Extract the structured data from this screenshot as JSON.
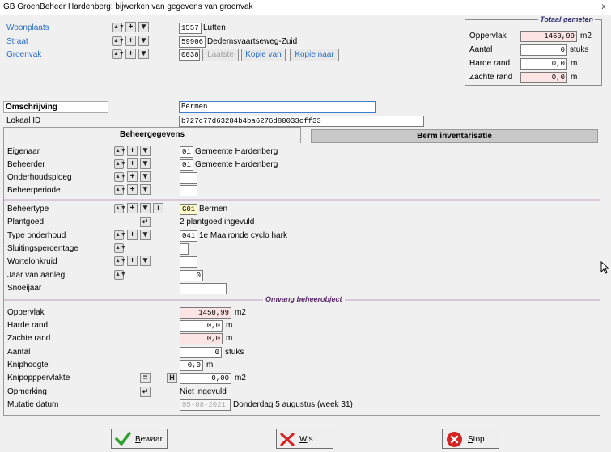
{
  "window": {
    "title": "GB GroenBeheer Hardenberg: bijwerken van gegevens van groenvak",
    "close": "x"
  },
  "header": {
    "woonplaats": {
      "label": "Woonplaats",
      "code": "1557",
      "value": "Lutten"
    },
    "straat": {
      "label": "Straat",
      "code": "59906",
      "value": "Dedemsvaartseweg-Zuid"
    },
    "groenvak": {
      "label": "Groenvak",
      "code": "0038",
      "btn_laatste": "Laatste",
      "btn_kopie_van": "Kopie van",
      "btn_kopie_naar": "Kopie naar"
    }
  },
  "totaal": {
    "title": "Totaal gemeten",
    "rows": [
      {
        "label": "Oppervlak",
        "value": "1450,99",
        "unit": "m2"
      },
      {
        "label": "Aantal",
        "value": "0",
        "unit": "stuks"
      },
      {
        "label": "Harde rand",
        "value": "0,0",
        "unit": "m"
      },
      {
        "label": "Zachte rand",
        "value": "0,0",
        "unit": "m"
      }
    ]
  },
  "omschrijving": {
    "label": "Omschrijving",
    "value": "Bermen"
  },
  "lokaal_id": {
    "label": "Lokaal ID",
    "value": "b727c77d63284b4ba6276d80033cff33"
  },
  "tabs": {
    "active": "Beheergegevens",
    "inactive": "Berm inventarisatie"
  },
  "eigendom": {
    "eigenaar": {
      "label": "Eigenaar",
      "code": "01",
      "value": "Gemeente Hardenberg"
    },
    "beheerder": {
      "label": "Beheerder",
      "code": "01",
      "value": "Gemeente Hardenberg"
    },
    "onderhoudsploeg": {
      "label": "Onderhoudsploeg"
    },
    "beheerperiode": {
      "label": "Beheerperiode"
    }
  },
  "beheer": {
    "beheertype": {
      "label": "Beheertype",
      "code": "G01",
      "value": "Bermen"
    },
    "plantgoed": {
      "label": "Plantgoed",
      "value": "2 plantgoed ingevuld"
    },
    "type_onderhoud": {
      "label": "Type onderhoud",
      "code": "041",
      "value": "1e Maaironde cyclo hark"
    },
    "sluitingspercentage": {
      "label": "Sluitingspercentage"
    },
    "wortelonkruid": {
      "label": "Wortelonkruid"
    },
    "jaar_van_aanleg": {
      "label": "Jaar van aanleg",
      "value": "0"
    },
    "snoeijaar": {
      "label": "Snoeijaar"
    }
  },
  "omvang": {
    "title": "Omvang beheerobject",
    "oppervlak": {
      "label": "Oppervlak",
      "value": "1450,99",
      "unit": "m2"
    },
    "harde_rand": {
      "label": "Harde rand",
      "value": "0,0",
      "unit": "m"
    },
    "zachte_rand": {
      "label": "Zachte rand",
      "value": "0,0",
      "unit": "m"
    },
    "aantal": {
      "label": "Aantal",
      "value": "0",
      "unit": "stuks"
    },
    "kniphoogte": {
      "label": "Kniphoogte",
      "value": "0,0",
      "unit": "m"
    },
    "knipoppervlakte": {
      "label": "Knipopppervlakte",
      "value": "0,00",
      "unit": "m2",
      "btn_eq": "=",
      "btn_h": "H"
    },
    "opmerking": {
      "label": "Opmerking",
      "value": "Niet ingevuld"
    },
    "mutatie_datum": {
      "label": "Mutatie datum",
      "value": "05-08-2021",
      "text": "Donderdag  5 augustus (week 31)"
    }
  },
  "footer": {
    "bewaar_prefix": "B",
    "bewaar_rest": "ewaar",
    "wis_prefix": "W",
    "wis_rest": "is",
    "stop_prefix": "S",
    "stop_rest": "top"
  },
  "colors": {
    "link": "#2a6ec8",
    "pink_field": "#fde4e4",
    "section_title": "#5a2a6a"
  }
}
